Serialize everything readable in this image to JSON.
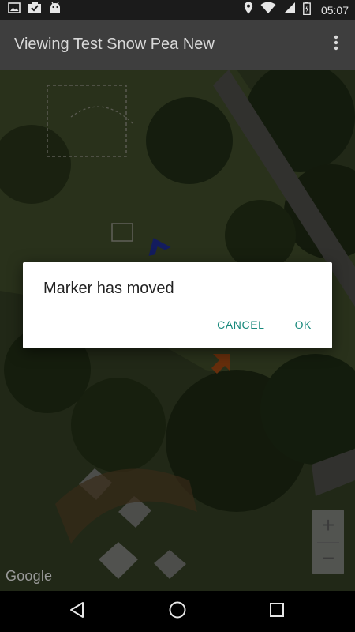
{
  "status_bar": {
    "time": "05:07",
    "left_icons": [
      "image-icon",
      "inbox-icon",
      "android-icon"
    ],
    "right_icons": [
      "location-icon",
      "wifi-icon",
      "signal-icon",
      "battery-icon"
    ]
  },
  "app_bar": {
    "title": "Viewing Test Snow Pea New",
    "overflow_icon": "more-vert-icon"
  },
  "map": {
    "attribution": "Google",
    "zoom_in_label": "+",
    "zoom_out_label": "−"
  },
  "dialog": {
    "message": "Marker has moved",
    "cancel_label": "CANCEL",
    "ok_label": "OK",
    "accent_color": "#16887b"
  },
  "nav_bar": {
    "icons": [
      "back-icon",
      "home-icon",
      "recents-icon"
    ]
  }
}
